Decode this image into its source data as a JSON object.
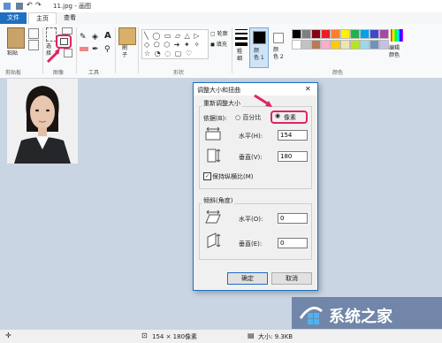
{
  "window": {
    "title": "11.jpg - 画图"
  },
  "tabs": [
    {
      "label": "文件"
    },
    {
      "label": "主页"
    },
    {
      "label": "查看"
    }
  ],
  "ribbon": {
    "clipboard": {
      "paste_label": "粘贴",
      "group_label": "剪贴板"
    },
    "image": {
      "select_label": "选\n择",
      "group_label": "图像"
    },
    "tools": {
      "group_label": "工具"
    },
    "brushes": {
      "label": "刷\n子"
    },
    "shapes": {
      "outline_label": "轮廓",
      "fill_label": "填充",
      "group_label": "形状"
    },
    "size": {
      "label": "粗\n细"
    },
    "color1": {
      "label": "颜\n色 1"
    },
    "color2": {
      "label": "颜\n色 2"
    },
    "colors": {
      "group_label": "颜色"
    },
    "edit_colors": {
      "label": "编辑\n颜色"
    },
    "palette_row1": [
      "#000000",
      "#7f7f7f",
      "#880015",
      "#ed1c24",
      "#ff7f27",
      "#fff200",
      "#22b14c",
      "#00a2e8",
      "#3f48cc",
      "#a349a4"
    ],
    "palette_row2": [
      "#ffffff",
      "#c3c3c3",
      "#b97a57",
      "#ffaec9",
      "#ffc90e",
      "#efe4b0",
      "#b5e61d",
      "#99d9ea",
      "#7092be",
      "#c8bfe7"
    ]
  },
  "dialog": {
    "title": "调整大小和扭曲",
    "resize_section": "重新调整大小",
    "by_label": "依据(B):",
    "percent_label": "百分比",
    "pixel_label": "像素",
    "horizontal_label": "水平(H):",
    "horizontal_value": "154",
    "vertical_label": "垂直(V):",
    "vertical_value": "180",
    "keep_ratio_label": "保持纵横比(M)",
    "skew_section": "倾斜(角度)",
    "skew_h_label": "水平(O):",
    "skew_h_value": "0",
    "skew_v_label": "垂直(E):",
    "skew_v_value": "0",
    "ok_label": "确定",
    "cancel_label": "取消",
    "close_glyph": "✕"
  },
  "statusbar": {
    "dimensions": "154 × 180像素",
    "size": "大小: 9.3KB"
  },
  "watermark": {
    "text": "系统之家"
  },
  "colors": {
    "accent": "#1e6fc0",
    "highlight": "#e0245e"
  }
}
